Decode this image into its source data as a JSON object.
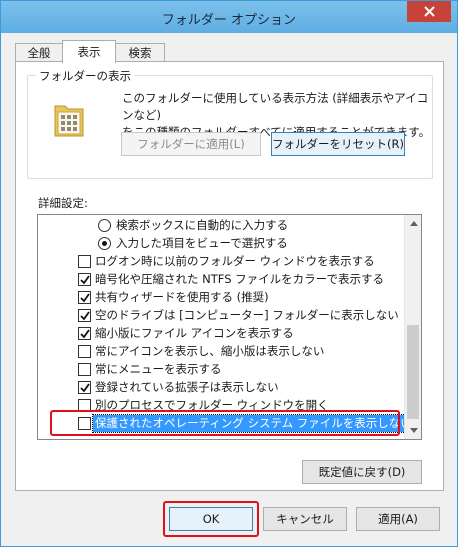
{
  "window": {
    "title": "フォルダー オプション"
  },
  "tabs": [
    {
      "label": "全般"
    },
    {
      "label": "表示"
    },
    {
      "label": "検索"
    }
  ],
  "folder_views": {
    "legend": "フォルダーの表示",
    "text_line1": "このフォルダーに使用している表示方法 (詳細表示やアイコンなど)",
    "text_line2": "をこの種類のフォルダーすべてに適用することができます。",
    "apply_button": "フォルダーに適用(L)",
    "reset_button": "フォルダーをリセット(R)"
  },
  "advanced": {
    "label": "詳細設定:",
    "items": [
      {
        "type": "radio",
        "checked": false,
        "label": "検索ボックスに自動的に入力する"
      },
      {
        "type": "radio",
        "checked": true,
        "label": "入力した項目をビューで選択する"
      },
      {
        "type": "checkbox",
        "checked": false,
        "label": "ログオン時に以前のフォルダー ウィンドウを表示する"
      },
      {
        "type": "checkbox",
        "checked": true,
        "label": "暗号化や圧縮された NTFS ファイルをカラーで表示する"
      },
      {
        "type": "checkbox",
        "checked": true,
        "label": "共有ウィザードを使用する (推奨)"
      },
      {
        "type": "checkbox",
        "checked": true,
        "label": "空のドライブは [コンピューター] フォルダーに表示しない"
      },
      {
        "type": "checkbox",
        "checked": true,
        "label": "縮小版にファイル アイコンを表示する"
      },
      {
        "type": "checkbox",
        "checked": false,
        "label": "常にアイコンを表示し、縮小版は表示しない"
      },
      {
        "type": "checkbox",
        "checked": false,
        "label": "常にメニューを表示する"
      },
      {
        "type": "checkbox",
        "checked": true,
        "label": "登録されている拡張子は表示しない"
      },
      {
        "type": "checkbox",
        "checked": false,
        "label": "別のプロセスでフォルダー ウィンドウを開く"
      },
      {
        "type": "checkbox",
        "checked": false,
        "label": "保護されたオペレーティング システム ファイルを表示しない (推奨)"
      }
    ],
    "restore_defaults_button": "既定値に戻す(D)"
  },
  "footer": {
    "ok_button": "OK",
    "cancel_button": "キャンセル",
    "apply_button": "適用(A)"
  },
  "colors": {
    "titlebar": "#6bb6e6",
    "close_button": "#c7433a",
    "selection": "#3399ff",
    "highlight_box": "#e0101b"
  }
}
